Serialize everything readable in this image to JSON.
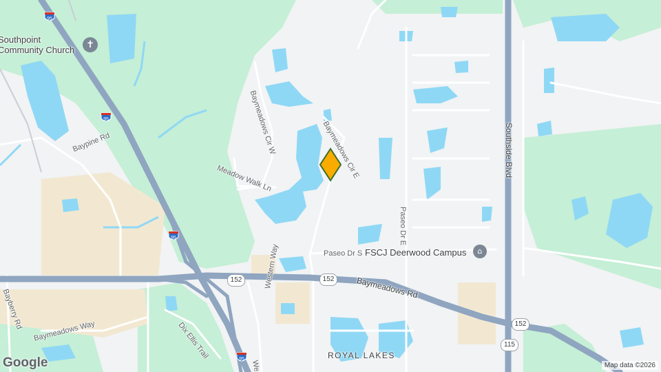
{
  "map": {
    "attribution": "Map data ©2026",
    "logo": "Google",
    "colors": {
      "background": "#f1f3f4",
      "park": "#c5efd6",
      "water": "#8fd8f5",
      "commercial": "#f2e8d2",
      "highway": "#8fa5c0",
      "street": "#ffffff",
      "marker": "#f9ab00"
    },
    "marker": {
      "name": "location-marker"
    }
  },
  "labels": {
    "church": "Southpoint\nCommunity Church",
    "fscj": "FSCJ Deerwood Campus",
    "royal_lakes": "ROYAL LAKES",
    "baypine": "Baypine Rd",
    "meadow_walk": "Meadow Walk Ln",
    "baymeadows_cir_w": "Baymeadows Cir W",
    "baymeadows_cir_e": "Baymeadows Cir E",
    "paseo_dr_s": "Paseo Dr S",
    "paseo_dr_e": "Paseo Dr E",
    "baymeadows_rd": "Baymeadows Rd",
    "southside": "Southside Blvd",
    "bayberry": "Bayberry Rd",
    "baymeadows_way": "Baymeadows Way",
    "dix_ellis": "Dix Ellis Trail",
    "western_way": "Western Way",
    "we_fragment": "We"
  },
  "shields": {
    "i95_top": "95",
    "i95_mid": "95",
    "i95_low": "95",
    "i95_bottom": "95",
    "sr152_a": "152",
    "sr152_b": "152",
    "sr152_c": "152",
    "sr115": "115"
  }
}
